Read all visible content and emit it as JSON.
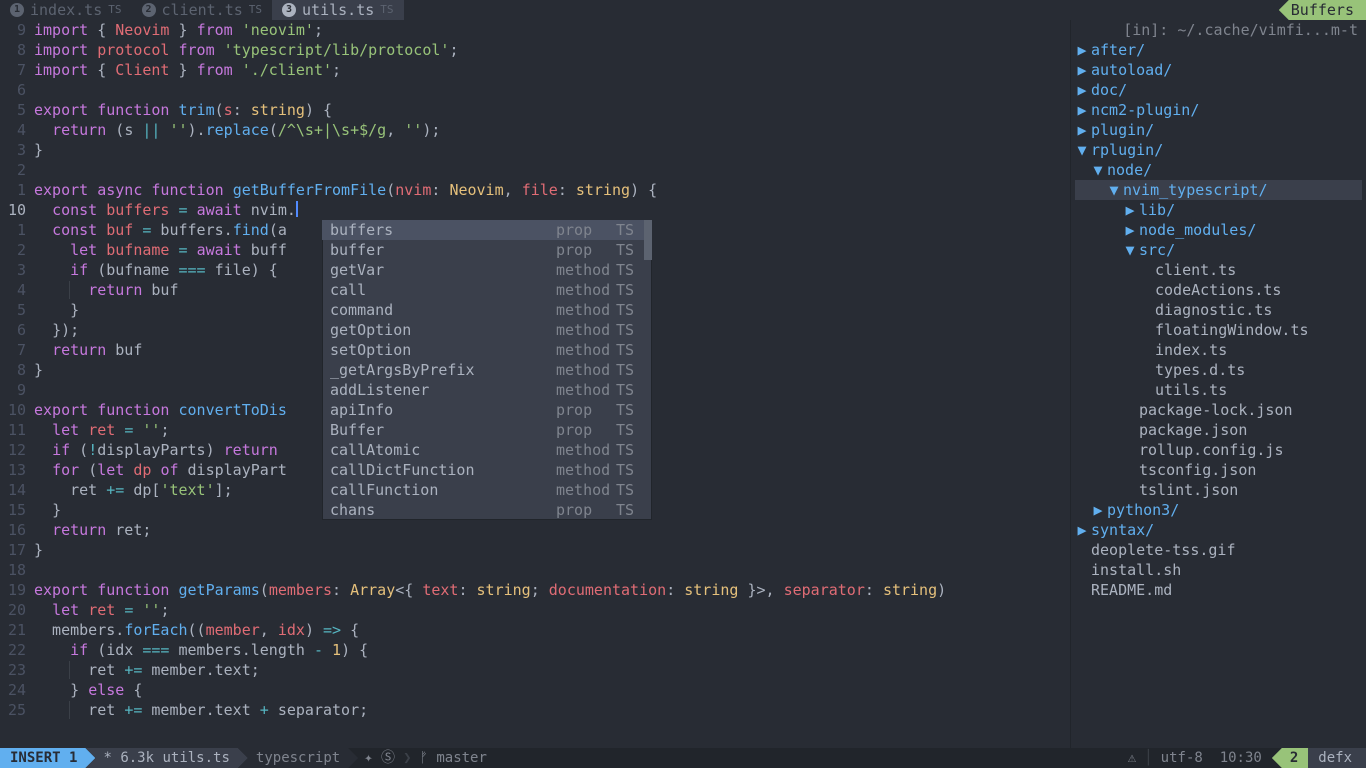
{
  "tabs": [
    {
      "num": "1",
      "name": "index.ts",
      "ft": "TS"
    },
    {
      "num": "2",
      "name": "client.ts",
      "ft": "TS"
    },
    {
      "num": "3",
      "name": "utils.ts",
      "ft": "TS"
    }
  ],
  "active_tab": 2,
  "buffers_label": "Buffers",
  "gutter": [
    "9",
    "8",
    "7",
    "6",
    "5",
    "4",
    "3",
    "2",
    "1",
    "10",
    "1",
    "2",
    "3",
    "4",
    "5",
    "6",
    "7",
    "8",
    "9",
    "10",
    "11",
    "12",
    "13",
    "14",
    "15",
    "16",
    "17",
    "18",
    "19",
    "20",
    "21",
    "22",
    "23",
    "24",
    "25"
  ],
  "current_line_index": 9,
  "completion": [
    {
      "name": "buffers",
      "kind": "prop",
      "src": "TS"
    },
    {
      "name": "buffer",
      "kind": "prop",
      "src": "TS"
    },
    {
      "name": "getVar",
      "kind": "method",
      "src": "TS"
    },
    {
      "name": "call",
      "kind": "method",
      "src": "TS"
    },
    {
      "name": "command",
      "kind": "method",
      "src": "TS"
    },
    {
      "name": "getOption",
      "kind": "method",
      "src": "TS"
    },
    {
      "name": "setOption",
      "kind": "method",
      "src": "TS"
    },
    {
      "name": "_getArgsByPrefix",
      "kind": "method",
      "src": "TS"
    },
    {
      "name": "addListener",
      "kind": "method",
      "src": "TS"
    },
    {
      "name": "apiInfo",
      "kind": "prop",
      "src": "TS"
    },
    {
      "name": "Buffer",
      "kind": "prop",
      "src": "TS"
    },
    {
      "name": "callAtomic",
      "kind": "method",
      "src": "TS"
    },
    {
      "name": "callDictFunction",
      "kind": "method",
      "src": "TS"
    },
    {
      "name": "callFunction",
      "kind": "method",
      "src": "TS"
    },
    {
      "name": "chans",
      "kind": "prop",
      "src": "TS"
    }
  ],
  "tree": {
    "header": "[in]: ~/.cache/vimfi...m-t",
    "entries": [
      {
        "depth": 0,
        "open": false,
        "type": "dir",
        "name": "after/"
      },
      {
        "depth": 0,
        "open": false,
        "type": "dir",
        "name": "autoload/"
      },
      {
        "depth": 0,
        "open": false,
        "type": "dir",
        "name": "doc/"
      },
      {
        "depth": 0,
        "open": false,
        "type": "dir",
        "name": "ncm2-plugin/"
      },
      {
        "depth": 0,
        "open": false,
        "type": "dir",
        "name": "plugin/"
      },
      {
        "depth": 0,
        "open": true,
        "type": "dir",
        "name": "rplugin/"
      },
      {
        "depth": 1,
        "open": true,
        "type": "dir",
        "name": "node/"
      },
      {
        "depth": 2,
        "open": true,
        "type": "dir",
        "name": "nvim_typescript/",
        "sel": true
      },
      {
        "depth": 3,
        "open": false,
        "type": "dir",
        "name": "lib/"
      },
      {
        "depth": 3,
        "open": false,
        "type": "dir",
        "name": "node_modules/"
      },
      {
        "depth": 3,
        "open": true,
        "type": "dir",
        "name": "src/"
      },
      {
        "depth": 4,
        "open": null,
        "type": "file",
        "name": "client.ts"
      },
      {
        "depth": 4,
        "open": null,
        "type": "file",
        "name": "codeActions.ts"
      },
      {
        "depth": 4,
        "open": null,
        "type": "file",
        "name": "diagnostic.ts"
      },
      {
        "depth": 4,
        "open": null,
        "type": "file",
        "name": "floatingWindow.ts"
      },
      {
        "depth": 4,
        "open": null,
        "type": "file",
        "name": "index.ts"
      },
      {
        "depth": 4,
        "open": null,
        "type": "file",
        "name": "types.d.ts"
      },
      {
        "depth": 4,
        "open": null,
        "type": "file",
        "name": "utils.ts"
      },
      {
        "depth": 3,
        "open": null,
        "type": "file",
        "name": "package-lock.json"
      },
      {
        "depth": 3,
        "open": null,
        "type": "file",
        "name": "package.json"
      },
      {
        "depth": 3,
        "open": null,
        "type": "file",
        "name": "rollup.config.js"
      },
      {
        "depth": 3,
        "open": null,
        "type": "file",
        "name": "tsconfig.json"
      },
      {
        "depth": 3,
        "open": null,
        "type": "file",
        "name": "tslint.json"
      },
      {
        "depth": 1,
        "open": false,
        "type": "dir",
        "name": "python3/"
      },
      {
        "depth": 0,
        "open": false,
        "type": "dir",
        "name": "syntax/"
      },
      {
        "depth": 0,
        "open": null,
        "type": "file",
        "name": "deoplete-tss.gif"
      },
      {
        "depth": 0,
        "open": null,
        "type": "file",
        "name": "install.sh"
      },
      {
        "depth": 0,
        "open": null,
        "type": "file",
        "name": "README.md"
      }
    ]
  },
  "status": {
    "mode": "INSERT 1",
    "file_mod": "*",
    "file_size": "6.3k",
    "file_name": "utils.ts",
    "filetype": "typescript",
    "git_icons": "✦ Ⓢ",
    "branch_icon": "ᚠ",
    "branch": "master",
    "warn_icon": "⚠",
    "encoding": "utf-8",
    "position": "10:30",
    "right_winnr": "2",
    "right_name": "defx"
  }
}
